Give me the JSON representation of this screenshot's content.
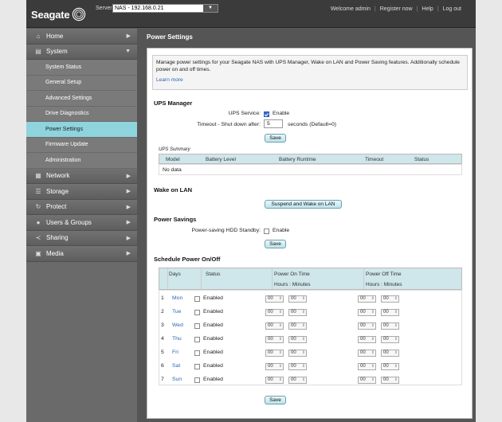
{
  "header": {
    "brand": "Seagate",
    "server_label": "Server:",
    "server_value": "NAS - 192.168.0.21",
    "links": [
      "Welcome admin",
      "Register now",
      "Help",
      "Log out"
    ]
  },
  "sidebar": {
    "items": [
      {
        "label": "Home",
        "icon": "home-icon"
      },
      {
        "label": "System",
        "icon": "system-icon",
        "expanded": true
      },
      {
        "label": "Network",
        "icon": "network-icon"
      },
      {
        "label": "Storage",
        "icon": "storage-icon"
      },
      {
        "label": "Protect",
        "icon": "protect-icon"
      },
      {
        "label": "Users & Groups",
        "icon": "users-icon"
      },
      {
        "label": "Sharing",
        "icon": "sharing-icon"
      },
      {
        "label": "Media",
        "icon": "media-icon"
      }
    ],
    "system_sub": [
      "System Status",
      "General Setup",
      "Advanced Settings",
      "Drive Diagnostics",
      "Power Settings",
      "Firmware Update",
      "Administration"
    ],
    "active_sub": "Power Settings"
  },
  "main": {
    "title": "Power Settings",
    "intro": "Manage power settings for your Seagate NAS with UPS Manager, Wake on LAN and Power Saving features. Additionally schedule power on and off times.",
    "learn_more": "Learn more",
    "ups": {
      "title": "UPS Manager",
      "service_label": "UPS Service:",
      "service_enable": "Enable",
      "service_checked": true,
      "timeout_label": "Timeout - Shut down after:",
      "timeout_value": "5",
      "timeout_suffix": "seconds (Default=0)",
      "save": "Save",
      "summary_label": "UPS Summary",
      "columns": [
        "Model",
        "Battery Level",
        "Battery Runtime",
        "Timeout",
        "Status"
      ],
      "empty": "No data"
    },
    "wol": {
      "title": "Wake on LAN",
      "button": "Suspend and Wake on LAN"
    },
    "savings": {
      "title": "Power Savings",
      "label": "Power-saving HDD Standby:",
      "enable": "Enable",
      "save": "Save"
    },
    "schedule": {
      "title": "Schedule Power On/Off",
      "col_days": "Days",
      "col_status": "Status",
      "col_on": "Power On Time",
      "col_off": "Power Off Time",
      "sub_on": "Hours : Minutes",
      "sub_off": "Hours : Minutes",
      "enabled_label": "Enabled",
      "time_default": "00",
      "rows": [
        {
          "num": "1",
          "day": "Mon"
        },
        {
          "num": "2",
          "day": "Tue"
        },
        {
          "num": "3",
          "day": "Wed"
        },
        {
          "num": "4",
          "day": "Thu"
        },
        {
          "num": "5",
          "day": "Fri"
        },
        {
          "num": "6",
          "day": "Sat"
        },
        {
          "num": "7",
          "day": "Sun"
        }
      ],
      "save": "Save"
    }
  }
}
